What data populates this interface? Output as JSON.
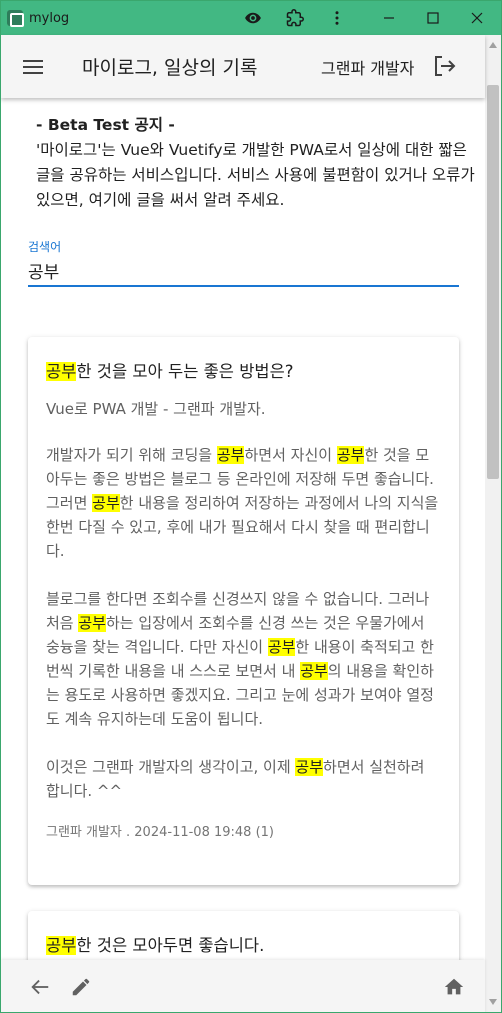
{
  "window": {
    "app_name": "mylog"
  },
  "appbar": {
    "title": "마이로그, 일상의 기록",
    "user": "그랜파 개발자"
  },
  "notice": {
    "title": "- Beta Test 공지 -",
    "body": "'마이로그'는 Vue와 Vuetify로 개발한 PWA로서 일상에 대한 짧은 글을 공유하는 서비스입니다. 서비스 사용에 불편함이 있거나 오류가 있으면, 여기에 글을 써서 알려 주세요."
  },
  "search": {
    "label": "검색어",
    "value": "공부"
  },
  "posts": [
    {
      "title_hl": "공부",
      "title_rest": "한 것을 모아 두는 좋은 방법은?",
      "subtitle": "Vue로 PWA 개발 - 그랜파 개발자.",
      "paragraphs": [
        [
          {
            "t": "개발자가 되기 위해 코딩을 "
          },
          {
            "t": "공부",
            "h": true
          },
          {
            "t": "하면서 자신이 "
          },
          {
            "t": "공부",
            "h": true
          },
          {
            "t": "한 것을 모아두는 좋은 방법은 블로그 등 온라인에 저장해 두면 좋습니다. 그러면 "
          },
          {
            "t": "공부",
            "h": true
          },
          {
            "t": "한 내용을 정리하여 저장하는 과정에서 나의 지식을 한번 다질 수 있고, 후에 내가 필요해서 다시 찾을 때 편리합니다."
          }
        ],
        [
          {
            "t": "블로그를 한다면 조회수를 신경쓰지 않을 수 없습니다. 그러나 처음 "
          },
          {
            "t": "공부",
            "h": true
          },
          {
            "t": "하는 입장에서 조회수를 신경 쓰는 것은 우물가에서 숭늉을 찾는 격입니다. 다만 자신이 "
          },
          {
            "t": "공부",
            "h": true
          },
          {
            "t": "한 내용이 축적되고 한번씩 기록한 내용을 내 스스로 보면서 내 "
          },
          {
            "t": "공부",
            "h": true
          },
          {
            "t": "의 내용을 확인하는 용도로 사용하면 좋겠지요. 그리고 눈에 성과가 보여야 열정도 계속 유지하는데 도움이 됩니다."
          }
        ],
        [
          {
            "t": "이것은 그랜파 개발자의 생각이고, 이제 "
          },
          {
            "t": "공부",
            "h": true
          },
          {
            "t": "하면서 실천하려 합니다. ^^"
          }
        ]
      ],
      "meta": "그랜파 개발자 . 2024-11-08 19:48 (1)"
    },
    {
      "title_hl": "공부",
      "title_rest": "한 것은 모아두면 좋습니다."
    }
  ],
  "icons": {
    "menu": "hamburger-menu-icon",
    "logout": "logout-icon",
    "back": "arrow-left-icon",
    "edit": "pencil-icon",
    "home": "home-icon",
    "eye": "eye-icon",
    "extension": "puzzle-icon",
    "more": "more-vert-icon"
  },
  "colors": {
    "titlebar": "#42b883",
    "accent": "#1976d2",
    "highlight": "#ffff00"
  }
}
